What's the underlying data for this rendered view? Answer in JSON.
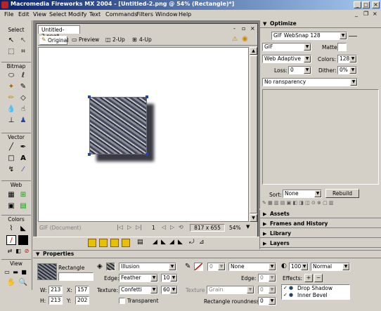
{
  "window": {
    "title": "Macromedia Fireworks MX 2004 - [Untitled-2.png @ 54% (Rectangle)*]",
    "min_label": "_",
    "max_label": "□",
    "close_label": "×"
  },
  "menu": {
    "items": [
      "File",
      "Edit",
      "View",
      "Select",
      "Modify",
      "Text",
      "Commands",
      "Filters",
      "Window",
      "Help"
    ]
  },
  "toolbox": {
    "sections": {
      "select": "Select",
      "bitmap": "Bitmap",
      "vector": "Vector",
      "web": "Web",
      "colors": "Colors",
      "view": "View"
    }
  },
  "document": {
    "tab": "Untitled-2.png*",
    "view_tabs": [
      "Original",
      "Preview",
      "2-Up",
      "4-Up"
    ],
    "status_format": "GIF (Document)",
    "page": "1",
    "size": "817 x 655",
    "zoom": "54%"
  },
  "optimize": {
    "header": "Optimize",
    "preset": "GIF WebSnap 128",
    "format": "GIF",
    "matte_label": "Matte:",
    "palette": "Web Adaptive",
    "colors_label": "Colors:",
    "colors_value": "128",
    "loss_label": "Loss:",
    "loss_value": "0",
    "dither_label": "Dither:",
    "dither_value": "0%",
    "transparency": "No  ransparency",
    "sort_label": "Sort:",
    "sort_value": "None",
    "rebuild_label": "Rebuild"
  },
  "panels": {
    "collapsed": [
      "Assets",
      "Frames and History",
      "Library",
      "Layers"
    ]
  },
  "properties": {
    "header": "Properties",
    "object_name": "Rectangle",
    "fill_kind": "Illusion",
    "edge_label": "Edge:",
    "edge_value": "Feather",
    "edge_amount": "10",
    "texture_label": "Texture:",
    "texture_value": "Confetti",
    "texture_amount": "60",
    "transparent_label": "Transparent",
    "stroke_value": "0",
    "stroke_kind": "None",
    "stroke_edge_label": "Edge:",
    "stroke_edge_value": "0",
    "stroke_texture_label": "Texture",
    "stroke_texture_value": "Grain",
    "stroke_texture_amount": "0",
    "roundness_label": "Rectangle roundness:",
    "roundness_value": "0",
    "opacity_value": "100",
    "blend_mode": "Normal",
    "effects_label": "Effects:",
    "effects": [
      "Drop Shadow",
      "Inner Bevel"
    ],
    "w_label": "W:",
    "w_value": "213",
    "x_label": "X:",
    "x_value": "157",
    "h_label": "H:",
    "h_value": "213",
    "y_label": "Y:",
    "y_value": "202"
  },
  "colors": {
    "title_start": "#0a246a",
    "title_end": "#a6caf0",
    "chrome": "#d4d0c8",
    "canvas": "#ffffff",
    "workspace": "#808080"
  }
}
